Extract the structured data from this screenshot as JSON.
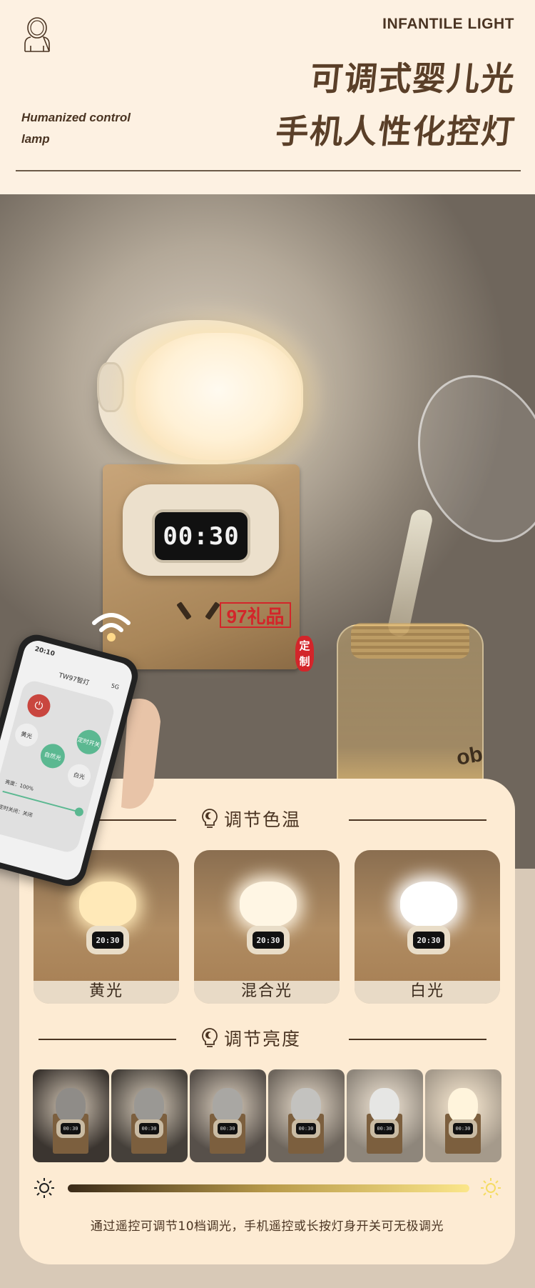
{
  "header": {
    "en_title": "INFANTILE LIGHT",
    "title_line1": "可调式婴儿光",
    "title_line2": "手机人性化控灯",
    "subtitle_line1": "Humanized control",
    "subtitle_line2": "lamp",
    "logo_icon": "astronaut-icon"
  },
  "hero": {
    "clock": "00:30",
    "jar_text": "ob",
    "watermark": "97礼品",
    "seal": "定制",
    "phone": {
      "time": "20:10",
      "app_title": "TW97智灯",
      "status": "5G",
      "buttons": [
        "黄光",
        "自然光",
        "白光",
        "定时开关"
      ],
      "brightness": "亮度：100%",
      "brightness_level": 1.0,
      "timer": "定时关闭：关闭"
    }
  },
  "color_temp": {
    "title": "调节色温",
    "icon": "bulb-icon",
    "items": [
      {
        "label": "黄光",
        "glow": "#ffe9b8",
        "clock": "20:30"
      },
      {
        "label": "混合光",
        "glow": "#fff6e4",
        "clock": "20:30"
      },
      {
        "label": "白光",
        "glow": "#ffffff",
        "clock": "20:30"
      }
    ]
  },
  "brightness": {
    "title": "调节亮度",
    "icon": "bulb-icon",
    "levels": [
      {
        "bg": "#3b3530",
        "head": "#8f8c88",
        "clock": "00:30"
      },
      {
        "bg": "#45403a",
        "head": "#9a9894",
        "clock": "00:30"
      },
      {
        "bg": "#57504a",
        "head": "#a9a7a3",
        "clock": "00:30"
      },
      {
        "bg": "#6e665d",
        "head": "#c3c2bf",
        "clock": "00:30"
      },
      {
        "bg": "#8e867b",
        "head": "#e6e6e4",
        "clock": "00:30"
      },
      {
        "bg": "#a59a8b",
        "head": "#fff4dc",
        "clock": "00:30"
      }
    ],
    "gradient_from": "#3a2a18",
    "gradient_to": "#fbe68a",
    "min_icon": "sun-dim-icon",
    "max_icon": "sun-bright-icon",
    "caption": "通过遥控可调节10档调光，手机遥控或长按灯身开关可无极调光"
  },
  "colors": {
    "header_bg": "#fdf1e2",
    "card_bg": "#fdebd3",
    "text": "#4a3422",
    "page_bg": "#d8c9b7"
  }
}
